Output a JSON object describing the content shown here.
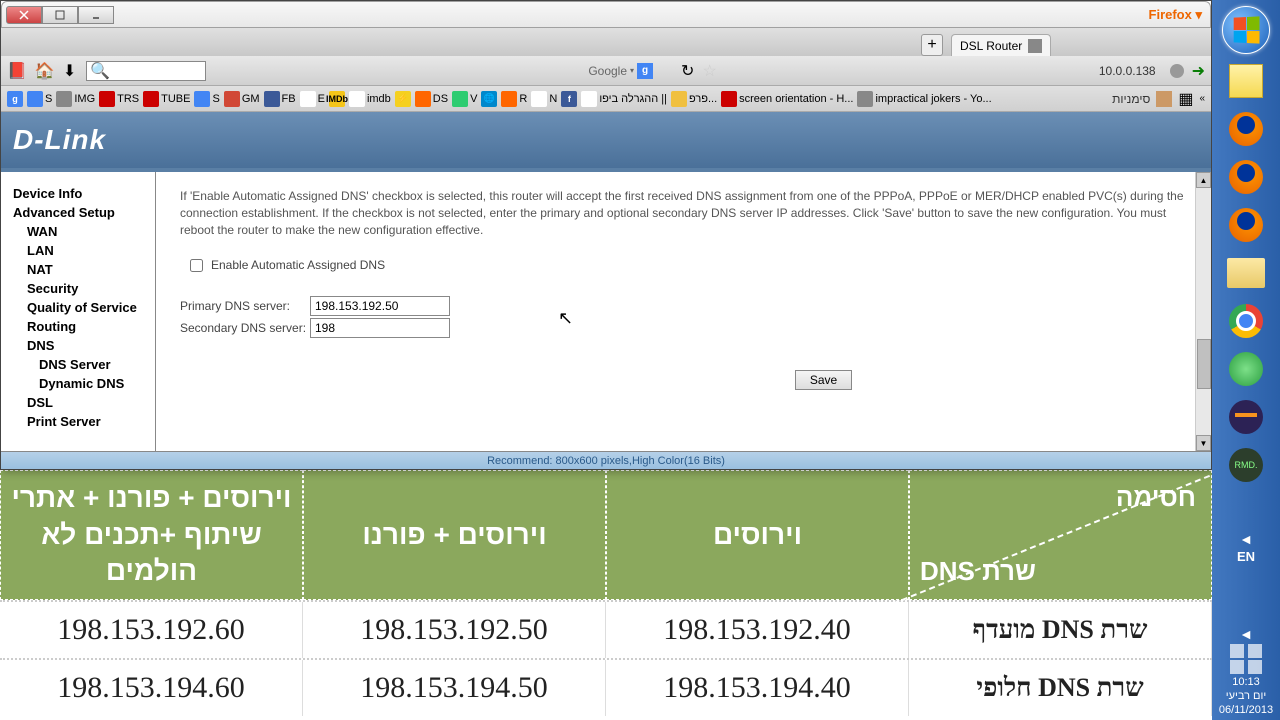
{
  "window": {
    "tab_title": "DSL Router",
    "url": "10.0.0.138",
    "search_engine": "Google",
    "bookmarks_label": "סימניות"
  },
  "bookmarks": [
    {
      "label": "impractical jokers - Yo...",
      "color": "#fff",
      "bg": "#888"
    },
    {
      "label": "screen orientation - H...",
      "color": "#fff",
      "bg": "#cc0000"
    },
    {
      "label": "פרפ...",
      "color": "#000",
      "bg": "#f0c040"
    },
    {
      "label": "ההגרלה ביפו ||",
      "color": "#000",
      "bg": "#fff"
    },
    {
      "label": "",
      "color": "#fff",
      "bg": "#3b5998",
      "txt": "f"
    },
    {
      "label": "N",
      "color": "#000",
      "bg": "#fff"
    },
    {
      "label": "R",
      "color": "#fff",
      "bg": "#ff6600"
    },
    {
      "label": "",
      "color": "#fff",
      "bg": "#0088cc",
      "txt": "🌐"
    },
    {
      "label": "V",
      "color": "#fff",
      "bg": "#2ecc71"
    },
    {
      "label": "DS",
      "color": "#fff",
      "bg": "#ff6600"
    },
    {
      "label": "",
      "color": "#000",
      "bg": "#f5d020",
      "txt": "⚡"
    },
    {
      "label": "imdb",
      "color": "#000",
      "bg": "#fff"
    },
    {
      "label": "",
      "color": "#000",
      "bg": "#f5c518",
      "txt": "IMDb"
    },
    {
      "label": "E",
      "color": "#000",
      "bg": "#fff"
    },
    {
      "label": "FB",
      "color": "#fff",
      "bg": "#3b5998"
    },
    {
      "label": "GM",
      "color": "#fff",
      "bg": "#d14836"
    },
    {
      "label": "S",
      "color": "#fff",
      "bg": "#4285f4"
    },
    {
      "label": "TUBE",
      "color": "#fff",
      "bg": "#cc0000"
    },
    {
      "label": "TRS",
      "color": "#fff",
      "bg": "#cc0000"
    },
    {
      "label": "IMG",
      "color": "#fff",
      "bg": "#888"
    },
    {
      "label": "S",
      "color": "#fff",
      "bg": "#4285f4"
    },
    {
      "label": "",
      "color": "#fff",
      "bg": "#4285f4",
      "txt": "g"
    }
  ],
  "router": {
    "logo": "D-Link",
    "sidebar": {
      "device_info": "Device Info",
      "advanced_setup": "Advanced Setup",
      "wan": "WAN",
      "lan": "LAN",
      "nat": "NAT",
      "security": "Security",
      "qos": "Quality of Service",
      "routing": "Routing",
      "dns": "DNS",
      "dns_server": "DNS Server",
      "dynamic_dns": "Dynamic DNS",
      "dsl": "DSL",
      "print_server": "Print Server"
    },
    "help_text": "If 'Enable Automatic Assigned DNS' checkbox is selected, this router will accept the first received DNS assignment from one of the PPPoA, PPPoE or MER/DHCP enabled PVC(s) during the connection establishment. If the checkbox is not selected, enter the primary and optional secondary DNS server IP addresses. Click 'Save' button to save the new configuration. You must reboot the router to make the new configuration effective.",
    "checkbox_label": "Enable Automatic Assigned DNS",
    "primary_dns_label": "Primary DNS server:",
    "primary_dns_value": "198.153.192.50",
    "secondary_dns_label": "Secondary DNS server:",
    "secondary_dns_value": "198",
    "save_button": "Save",
    "status_bar": "Recommend: 800x600 pixels,High Color(16 Bits)"
  },
  "bg_table": {
    "headers": {
      "corner_top": "חסימה",
      "corner_bot": "שרת DNS",
      "col3": "וירוסים",
      "col2": "וירוסים + פורנו",
      "col1": "וירוסים + פורנו + אתרי שיתוף +תכנים לא הולמים"
    },
    "rows": [
      {
        "label": "שרת DNS מועדף",
        "c3": "198.153.192.40",
        "c2": "198.153.192.50",
        "c1": "198.153.192.60"
      },
      {
        "label": "שרת DNS חלופי",
        "c3": "198.153.194.40",
        "c2": "198.153.194.50",
        "c1": "198.153.194.60"
      }
    ]
  },
  "systray": {
    "lang": "EN",
    "time": "10:13",
    "date_label": "יום רביעי",
    "date": "06/11/2013"
  }
}
